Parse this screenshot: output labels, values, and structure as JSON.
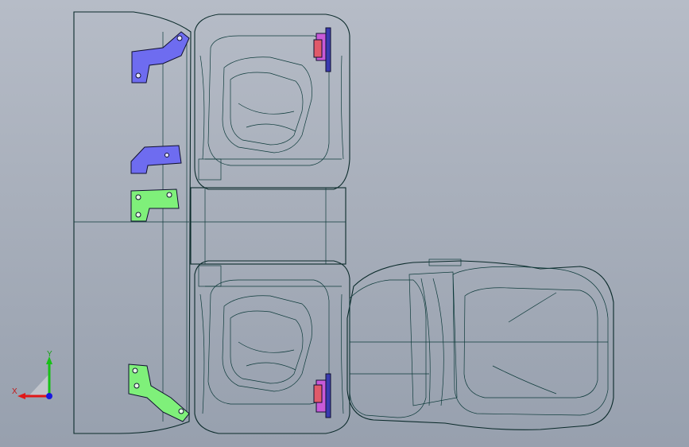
{
  "viewport": {
    "background_top": "#b6bcc7",
    "background_bottom": "#97a0ae",
    "model_color": "#14f0e6",
    "model_shade_color": "#0fc4c4",
    "bracket_blue_color": "#6e6cf0",
    "bracket_green_color": "#7ff07a",
    "bracket_red_color": "#e05a6a",
    "bracket_magenta_color": "#c85ad8"
  },
  "triad": {
    "x_label": "X",
    "y_label": "Y",
    "x_color": "#e01818",
    "y_color": "#18c018",
    "z_color": "#1818e0"
  }
}
